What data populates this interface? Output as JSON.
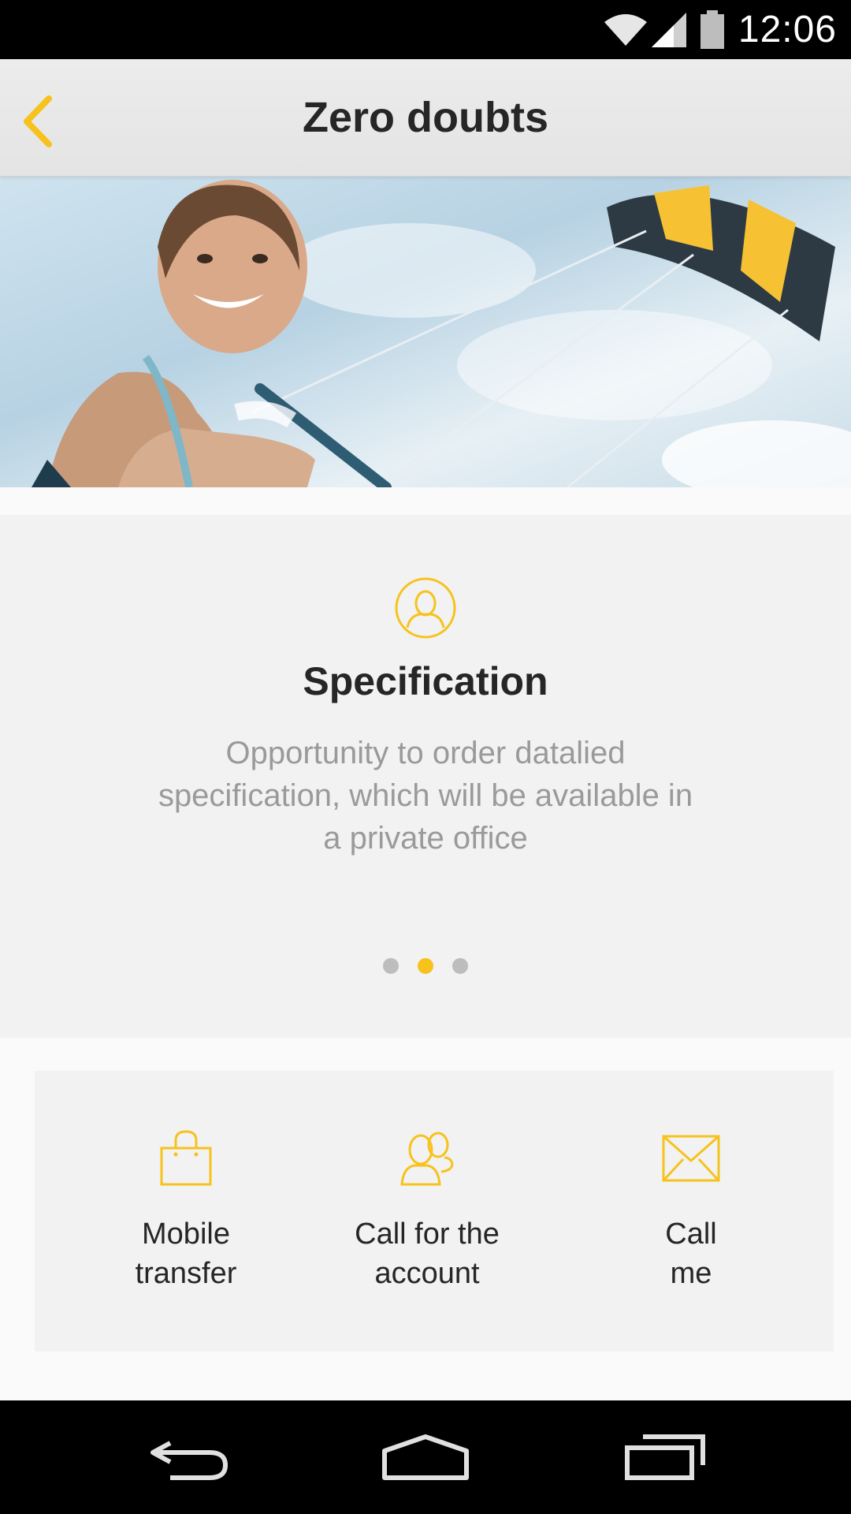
{
  "status_bar": {
    "time": "12:06",
    "icons": [
      "wifi-icon",
      "signal-icon",
      "battery-icon"
    ]
  },
  "header": {
    "title": "Zero doubts",
    "back_icon": "chevron-left-icon"
  },
  "hero": {
    "image": "kitesurfer-photo"
  },
  "carousel": {
    "icon": "user-circle-icon",
    "title": "Specification",
    "description": "Opportunity to order datalied specification, which will be available in a private office",
    "page_count": 3,
    "active_index": 1
  },
  "actions": [
    {
      "icon": "shopping-bag-icon",
      "line1": "Mobile",
      "line2": "transfer"
    },
    {
      "icon": "users-icon",
      "line1": "Call for the",
      "line2": "account"
    },
    {
      "icon": "envelope-icon",
      "line1": "Call",
      "line2": "me"
    }
  ],
  "nav_bar": {
    "buttons": [
      "back-icon",
      "home-icon",
      "recents-icon"
    ]
  },
  "colors": {
    "accent": "#f7c21c",
    "text_dark": "#262626",
    "text_muted": "#9a9a9a"
  }
}
